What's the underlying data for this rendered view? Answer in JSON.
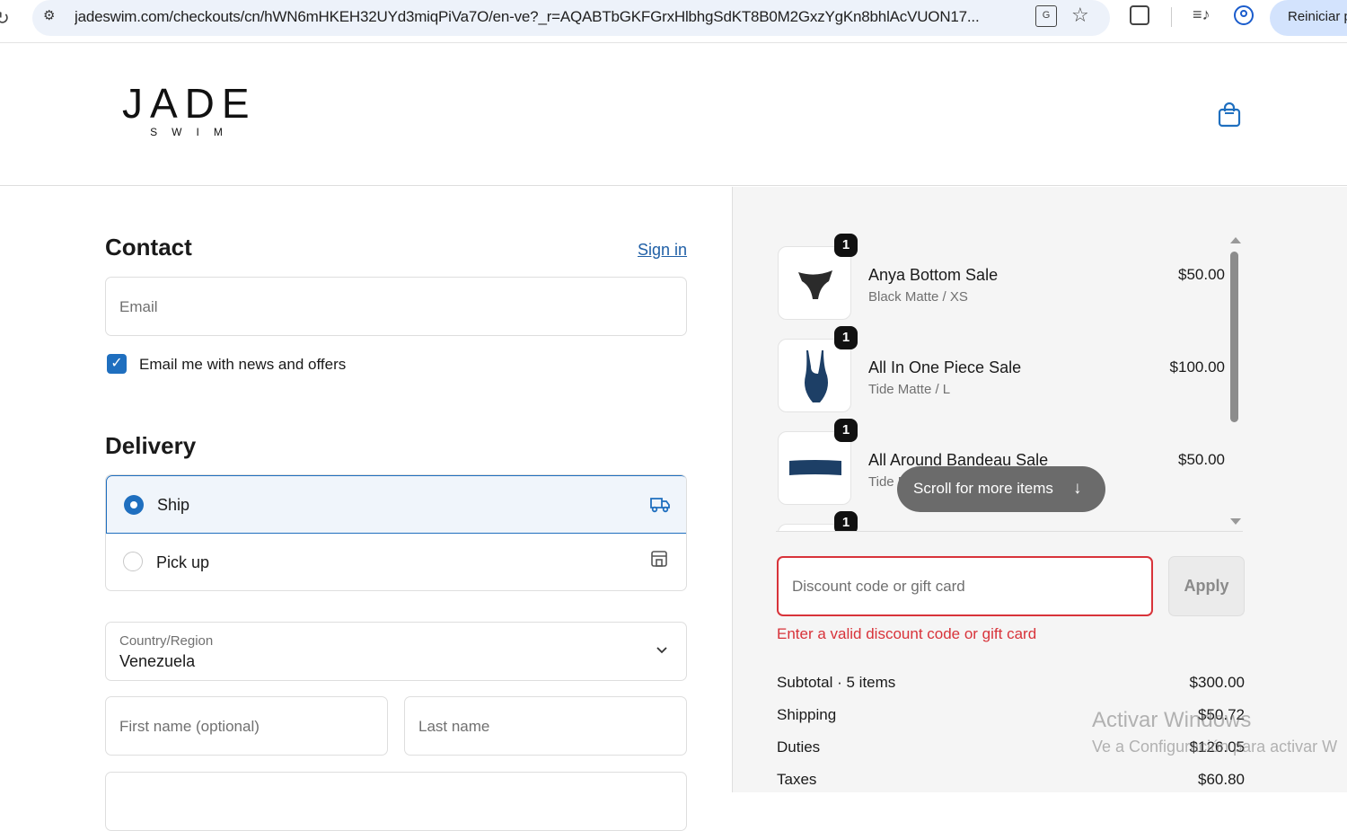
{
  "browser": {
    "url": "jadeswim.com/checkouts/cn/hWN6mHKEH32UYd3miqPiVa7O/en-ve?_r=AQABTbGKFGrxHlbhgSdKT8B0M2GxzYgKn8bhlAcVUON17...",
    "restart_label": "Reiniciar p"
  },
  "header": {
    "logo_main": "JADE",
    "logo_sub": "SWIM"
  },
  "contact": {
    "title": "Contact",
    "signin_label": "Sign in",
    "email_placeholder": "Email",
    "newsletter_label": "Email me with news and offers",
    "newsletter_checked": true
  },
  "delivery": {
    "title": "Delivery",
    "options": [
      {
        "label": "Ship",
        "selected": true
      },
      {
        "label": "Pick up",
        "selected": false
      }
    ],
    "country_label": "Country/Region",
    "country_value": "Venezuela",
    "first_name_placeholder": "First name (optional)",
    "last_name_placeholder": "Last name"
  },
  "cart": {
    "items": [
      {
        "name": "Anya Bottom Sale",
        "variant": "Black Matte / XS",
        "price": "$50.00",
        "qty": "1"
      },
      {
        "name": "All In One Piece Sale",
        "variant": "Tide Matte / L",
        "price": "$100.00",
        "qty": "1"
      },
      {
        "name": "All Around Bandeau Sale",
        "variant": "Tide M",
        "price": "$50.00",
        "qty": "1"
      },
      {
        "qty": "1"
      }
    ],
    "scroll_more_label": "Scroll for more items",
    "discount_placeholder": "Discount code or gift card",
    "apply_label": "Apply",
    "discount_error": "Enter a valid discount code or gift card",
    "summary": [
      {
        "label": "Subtotal · 5 items",
        "value": "$300.00"
      },
      {
        "label": "Shipping",
        "value": "$50.72"
      },
      {
        "label": "Duties",
        "value": "$126.05"
      },
      {
        "label": "Taxes",
        "value": "$60.80"
      }
    ]
  },
  "watermark": {
    "line1": "Activar Windows",
    "line2": "Ve a Configuración para activar W"
  },
  "colors": {
    "accent": "#1f6fbf",
    "error": "#d8333a",
    "swimsuit_black": "#2b2b2b",
    "swimsuit_tide": "#1d3f66"
  }
}
